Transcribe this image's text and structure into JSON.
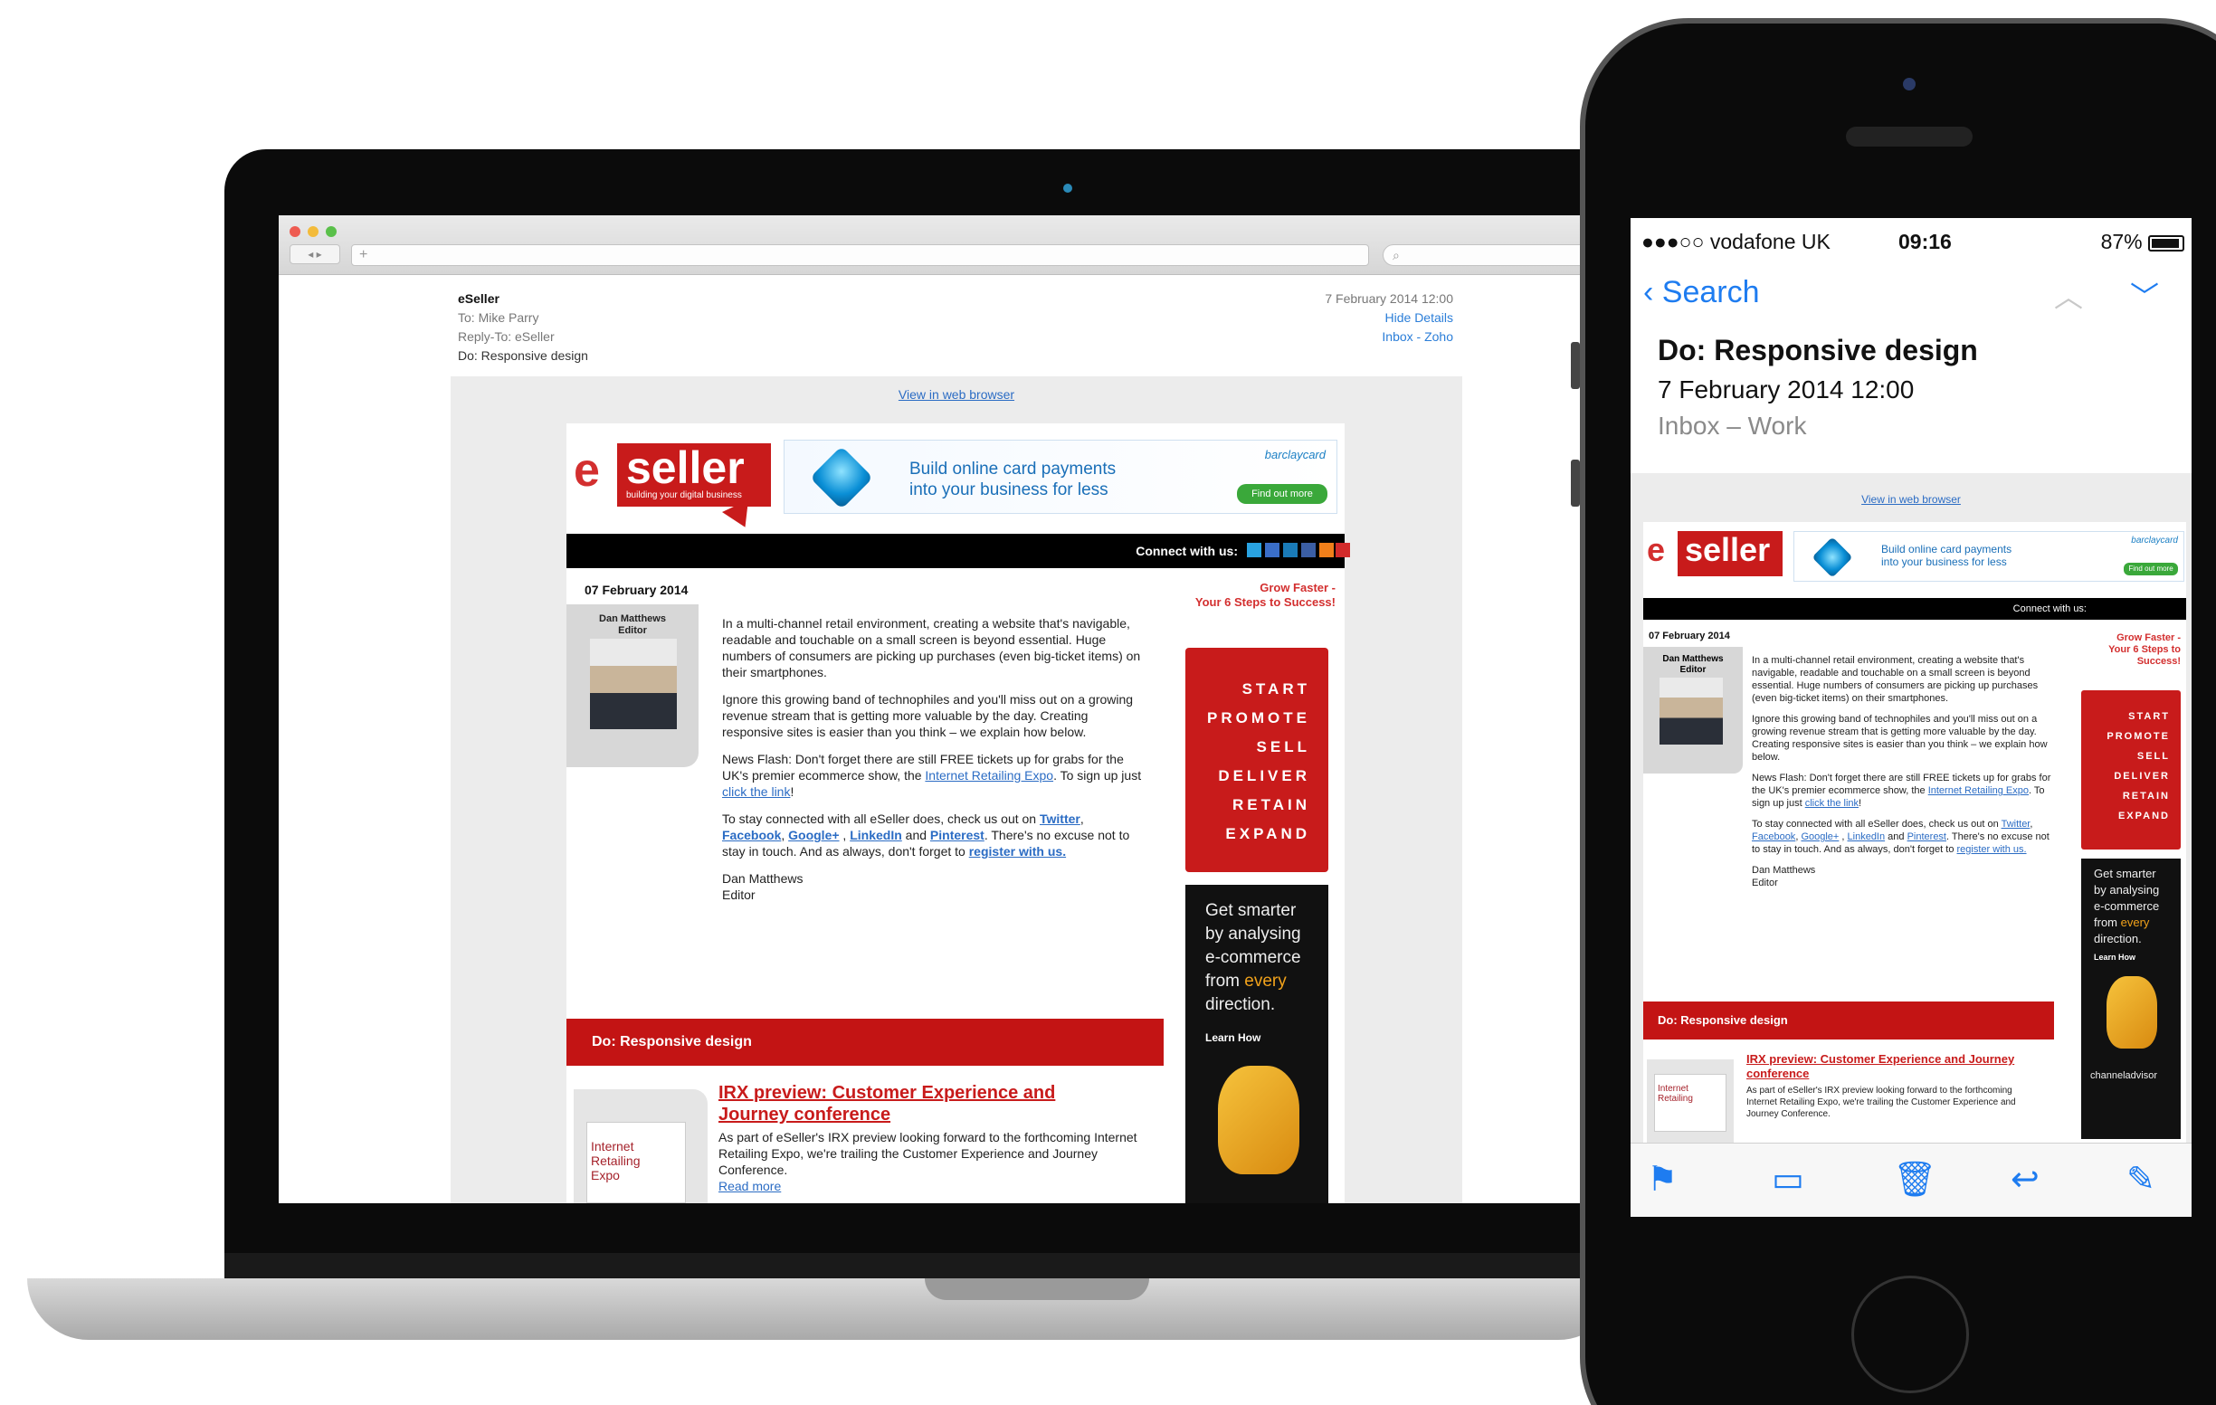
{
  "laptop": {
    "browser": {
      "url_plus": "+",
      "nav": "◂ ▸",
      "search_glyph": "⌕"
    },
    "mail": {
      "from": "eSeller",
      "to": "To:  Mike Parry",
      "reply_to": "Reply-To:  eSeller",
      "subject": "Do: Responsive design",
      "date": "7 February 2014 12:00",
      "hide_details": "Hide Details",
      "mailbox": "Inbox - Zoho"
    }
  },
  "newsletter": {
    "view_web": "View in web browser",
    "logo_e": "e",
    "logo_text": "seller",
    "logo_tagline": "building your digital business",
    "ad_text_1": "Build online card payments",
    "ad_text_2": "into your business for less",
    "ad_brand": "barclaycard",
    "ad_button": "Find out more",
    "connect": "Connect with us:",
    "date": "07 February 2014",
    "editor_name": "Dan Matthews",
    "editor_role": "Editor",
    "para1": "In a multi-channel retail environment, creating a website that's navigable, readable and touchable on a small screen is beyond essential. Huge numbers of consumers are picking up purchases (even big-ticket items) on their smartphones.",
    "para2": "Ignore this growing band of technophiles and you'll miss out on a growing revenue stream that is getting more valuable by the day. Creating responsive sites is easier than you think – we explain how below.",
    "para3_a": "News Flash: Don't forget there are still FREE tickets up for grabs for the UK's premier ecommerce show, the ",
    "para3_link1": "Internet Retailing Expo",
    "para3_b": ". To sign up just ",
    "para3_link2": "click the link",
    "para3_c": "!",
    "para4_a": "To stay connected with all eSeller does, check us out on ",
    "link_twitter": "Twitter",
    "link_facebook": "Facebook",
    "link_google": "Google+",
    "link_linkedin": "LinkedIn",
    "para4_and": " and ",
    "link_pinterest": "Pinterest",
    "para4_b": ". There's no excuse not to stay in touch. And as always, don't forget to ",
    "link_register": "register with us.",
    "sign_name": "Dan Matthews",
    "sign_role": "Editor",
    "side_title_1": "Grow Faster -",
    "side_title_2": "Your 6 Steps to Success!",
    "steps": [
      "START",
      "PROMOTE",
      "SELL",
      "DELIVER",
      "RETAIN",
      "EXPAND"
    ],
    "dark_ad_1": "Get smarter",
    "dark_ad_2": "by analysing",
    "dark_ad_3": "e-commerce",
    "dark_ad_4a": "from ",
    "dark_ad_4b": "every",
    "dark_ad_5": "direction.",
    "dark_ad_cta": "Learn How",
    "dark_ad_brand": "channeladvisor",
    "section": "Do: Responsive design",
    "article_img_text": "Internet Retailing",
    "article_img_sub": "Expo",
    "article_title": "IRX preview: Customer Experience and Journey conference",
    "article_body": "As part of eSeller's IRX preview looking forward to the forthcoming Internet Retailing Expo, we're trailing the Customer Experience and Journey Conference.",
    "read_more": "Read more"
  },
  "phone": {
    "status": {
      "carrier": "●●●○○ vodafone UK",
      "time": "09:16",
      "battery": "87%"
    },
    "nav": {
      "back": "Search",
      "up": "︿",
      "down": "﹀"
    },
    "subject": "Do: Responsive design",
    "date": "7 February 2014 12:00",
    "folder": "Inbox – Work",
    "toolbar": {
      "flag": "⚑",
      "folder": "▭",
      "trash": "🗑",
      "reply": "↩",
      "compose": "✎"
    }
  },
  "colors": {
    "brand_red": "#c81b1b",
    "ios_blue": "#1e7cf0",
    "link_blue": "#2b6cc4"
  }
}
